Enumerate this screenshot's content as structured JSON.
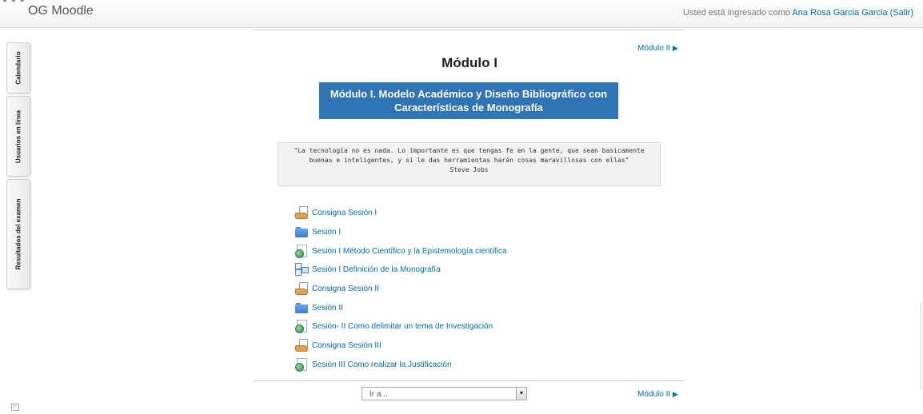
{
  "header": {
    "site_name": "OG Moodle",
    "login_prefix": "Usted está ingresado como",
    "user_name": "Ana Rosa Garcia Garcia",
    "logout_label": "(Salir)"
  },
  "sidebar": {
    "tabs": [
      {
        "label": "Calendario"
      },
      {
        "label": "Usuarios en línea"
      },
      {
        "label": "Resultados del examen"
      }
    ]
  },
  "section": {
    "next_link_top": "Módulo II",
    "next_link_bottom": "Módulo II",
    "title": "Módulo I",
    "banner_line1": "Módulo I. Modelo Académico y Diseño Bibliográfico con",
    "banner_line2": "Características de Monografía",
    "quote_line1": "\"La tecnología no es nada. Lo importante es que tengas fe en la gente, que sean basicamente",
    "quote_line2": "buenas e inteligentes, y si le das herramientas harán cosas maravillosas con ellas\"",
    "quote_author": "Steve Jobs"
  },
  "activities": [
    {
      "label": "Consigna Sesión I",
      "icon": "assignment-icon"
    },
    {
      "label": "Sesión I",
      "icon": "folder-icon"
    },
    {
      "label": "Sesión I Método Científico y la Epistemología científica",
      "icon": "url-icon"
    },
    {
      "label": "Sesión I Definición de la Monografía",
      "icon": "book-icon"
    },
    {
      "label": "Consigna Sesión II",
      "icon": "assignment-icon"
    },
    {
      "label": "Sesión II",
      "icon": "folder-icon"
    },
    {
      "label": "Sesión- II Como delimitar un tema de Investigación",
      "icon": "url-icon"
    },
    {
      "label": "Consigna Sesión III",
      "icon": "assignment-icon"
    },
    {
      "label": "Sesión III Como realizar la Justificación",
      "icon": "url-icon"
    }
  ],
  "jump_menu": {
    "selected": "Ir a..."
  },
  "colors": {
    "link": "#0070a8",
    "banner": "#2f74b5"
  }
}
